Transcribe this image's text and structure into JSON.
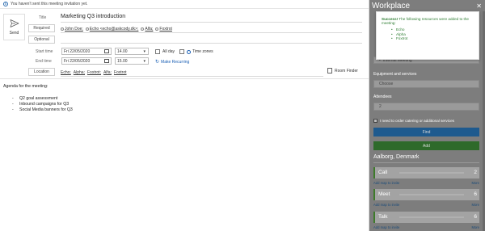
{
  "infobar": {
    "text": "You haven't sent this meeting invitation yet."
  },
  "compose": {
    "send_label": "Send",
    "title_label": "Title",
    "title_value": "Marketing Q3 introduction",
    "required_label": "Required",
    "optional_label": "Optional",
    "recipients": [
      "John Doe;",
      "Echo <echo@askcody.dk>;",
      "Alfa;",
      "Foxtrot"
    ],
    "start_label": "Start time",
    "end_label": "End time",
    "start_date": "Fri 22/05/2020",
    "start_time": "14.00",
    "end_date": "Fri 22/05/2020",
    "end_time": "15.00",
    "all_day_label": "All day",
    "time_zones_label": "Time zones",
    "make_recurring_label": "Make Recurring",
    "location_label": "Location",
    "locations": [
      "Echo;",
      "Alpha;",
      "Foxtrot;",
      "Alfa;",
      "Foxtrot"
    ],
    "room_finder_label": "Room Finder",
    "body_heading": "Agenda for the meeting:",
    "agenda": [
      "Q2 goal assessment",
      "Inbound campaigns for Q3",
      "Social Media banners for Q3"
    ]
  },
  "pane": {
    "title": "Workplace",
    "close": "✕",
    "popup": {
      "success_bold": "Success!",
      "success_text": " The following resources were added to the meeting:",
      "items": [
        "Echo",
        "Alpha",
        "Foxtrot"
      ]
    },
    "internal_meeting": "Internal Meeting",
    "equipment_label": "Equipment and services",
    "equipment_placeholder": "Choose",
    "attendees_label": "Attendees",
    "attendees_value": "2",
    "catering_label": "I need to order catering or additional services",
    "find_label": "Find",
    "add_label": "Add",
    "city": "Aalborg, Denmark",
    "rooms": [
      {
        "name": "Call",
        "count": "2"
      },
      {
        "name": "Meet",
        "count": "6"
      },
      {
        "name": "Talk",
        "count": "6"
      }
    ],
    "add_map_label": "Add map to invite",
    "more_label": "More"
  }
}
